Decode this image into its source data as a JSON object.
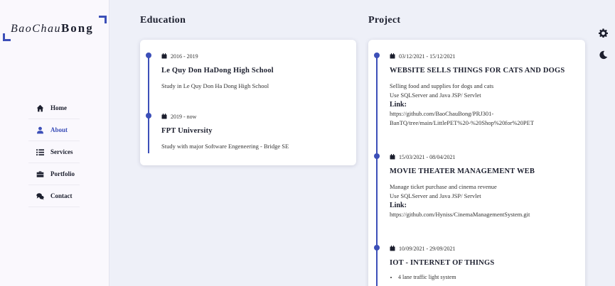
{
  "logo": {
    "script": "BaoChau",
    "bold": "Bong"
  },
  "nav": {
    "items": [
      {
        "label": "Home",
        "icon": "home-icon"
      },
      {
        "label": "About",
        "icon": "user-icon",
        "active": true
      },
      {
        "label": "Services",
        "icon": "list-icon"
      },
      {
        "label": "Portfolio",
        "icon": "briefcase-icon"
      },
      {
        "label": "Contact",
        "icon": "chat-icon"
      }
    ]
  },
  "education": {
    "title": "Education",
    "entries": [
      {
        "date": "2016 - 2019",
        "title": "Le Quy Don HaDong High School",
        "desc": "Study in Le Quy Don Ha Dong High School"
      },
      {
        "date": "2019 - now",
        "title": "FPT University",
        "desc": "Study with major Software Engeneering - Bridge SE"
      }
    ]
  },
  "project": {
    "title": "Project",
    "entries": [
      {
        "date": "03/12/2021 - 15/12/2021",
        "title": "WEBSITE SELLS THINGS FOR CATS AND DOGS",
        "desc1": "Selling food and supplies for dogs and cats",
        "desc2": "Use SQLServer and Java JSP/ Servlet",
        "link_label": "Link:",
        "link1": "https://github.com/BaoChauBong/PRJ301-",
        "link2": "BanTQ/tree/main/LittlePET%20-%20Shop%20for%20PET"
      },
      {
        "date": "15/03/2021 - 08/04/2021",
        "title": "MOVIE THEATER MANAGEMENT WEB",
        "desc1": "Manage ticket purchase and cinema revenue",
        "desc2": "Use SQLServer and Java JSP/ Servlet",
        "link_label": "Link:",
        "link1": "https://github.com/Hyniss/CinemaManagementSystem.git"
      },
      {
        "date": "10/09/2021 - 29/09/2021",
        "title": "IOT - INTERNET OF THINGS",
        "bullet1": "4 lane traffic light system"
      }
    ]
  },
  "colors": {
    "accent": "#3c4fb8",
    "background": "#eef0f8",
    "sidebar": "#faf8fd"
  }
}
